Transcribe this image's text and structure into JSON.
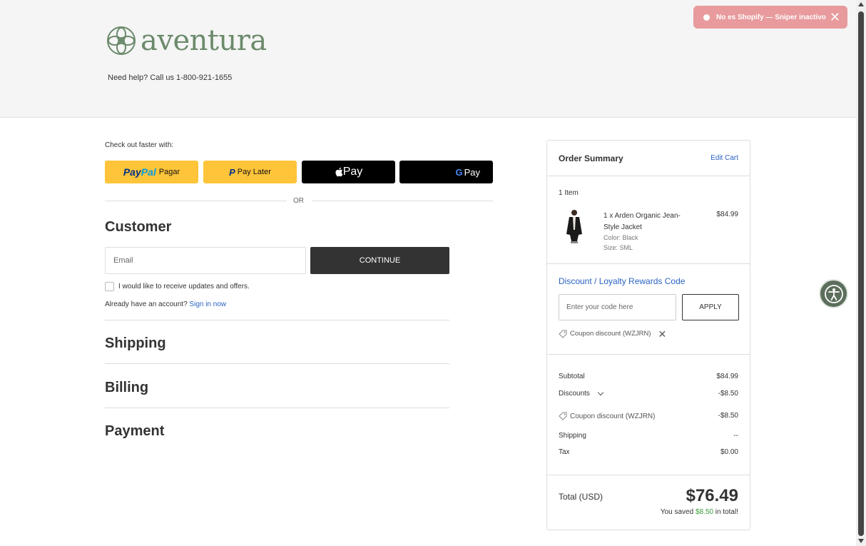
{
  "header": {
    "brand": "aventura",
    "help_text": "Need help? Call us 1-800-921-1655"
  },
  "toast": {
    "text": "No es Shopify — Sniper inactivo",
    "close": "✕"
  },
  "checkout": {
    "fast_label": "Check out faster with:",
    "paypal": {
      "logo_a": "Pay",
      "logo_b": "Pal",
      "label": "Pagar"
    },
    "paylater": {
      "logo": "P",
      "label": "Pay Later"
    },
    "applepay": {
      "label": " Pay"
    },
    "gpay": {
      "g": "G",
      "label": "Pay"
    },
    "or": "OR"
  },
  "customer": {
    "title": "Customer",
    "email_placeholder": "Email",
    "continue_label": "CONTINUE",
    "updates_label": "I would like to receive updates and offers.",
    "account_text": "Already have an account?",
    "signin_label": "Sign in now"
  },
  "sections": {
    "shipping": "Shipping",
    "billing": "Billing",
    "payment": "Payment"
  },
  "summary": {
    "title": "Order Summary",
    "edit_cart": "Edit Cart",
    "item_count": "1 Item",
    "product": {
      "name": "1 x Arden Organic Jean-Style Jacket",
      "color": "Color: Black",
      "size": "Size: SML",
      "price": "$84.99"
    },
    "discount_title": "Discount / Loyalty Rewards Code",
    "code_placeholder": "Enter your code here",
    "apply_label": "APPLY",
    "coupon_chip": "Coupon discount (WZJRN)",
    "coupon_remove": "✕",
    "lines": {
      "subtotal_label": "Subtotal",
      "subtotal_value": "$84.99",
      "discounts_label": "Discounts",
      "discounts_value": "-$8.50",
      "coupon_label": "Coupon discount (WZJRN)",
      "coupon_value": "-$8.50",
      "shipping_label": "Shipping",
      "shipping_value": "--",
      "tax_label": "Tax",
      "tax_value": "$0.00"
    },
    "total_label": "Total (USD)",
    "total_value": "$76.49",
    "saved_prefix": "You saved ",
    "saved_amount": "$8.50",
    "saved_suffix": " in total!"
  },
  "colors": {
    "brand_green": "#6b8a6b",
    "link_blue": "#2a63c4",
    "paypal_yellow": "#ffc439",
    "toast_red": "#e89a9d",
    "saved_green": "#3a9d3a"
  }
}
